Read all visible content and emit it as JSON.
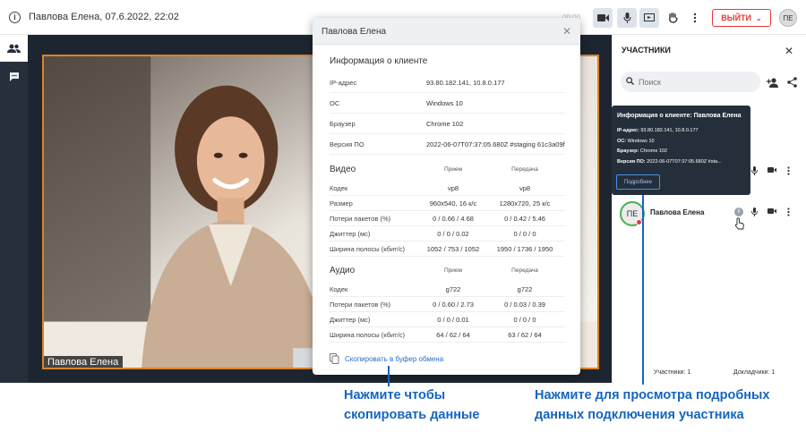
{
  "topbar": {
    "title": "Павлова Елена, 07.6.2022, 22:02",
    "timer": "00:00",
    "exit_label": "ВЫЙТИ",
    "avatar_initials": "ПЕ",
    "icons": [
      "info-icon",
      "camera-icon",
      "mic-icon",
      "screen-share-icon",
      "raise-hand-icon",
      "more-vert-icon"
    ]
  },
  "rail": {
    "icons": [
      "participants-icon",
      "chat-icon"
    ]
  },
  "video": {
    "participant_name": "Павлова Елена"
  },
  "panel": {
    "title": "УЧАСТНИКИ",
    "search_placeholder": "Поиск",
    "participant": {
      "initials": "ПЕ",
      "name": "Павлова Елена"
    },
    "footer_participants": "Участники: 1",
    "footer_speakers": "Докладчики: 1"
  },
  "tooltip": {
    "title": "Информация о клиенте: Павлова Елена",
    "lines": [
      {
        "label": "IP-адрес:",
        "value": "93.80.182.141, 10.8.0.177"
      },
      {
        "label": "ОС:",
        "value": "Windows 10"
      },
      {
        "label": "Браузер:",
        "value": "Chrome 102"
      },
      {
        "label": "Версия ПО:",
        "value": "2022-06-07T07:37:05.680Z #sta..."
      }
    ],
    "details_button": "Подробнее"
  },
  "modal": {
    "title": "Павлова Елена",
    "client_section": "Информация о клиенте",
    "client_rows": [
      {
        "key": "IP-адрес",
        "value": "93.80.182.141, 10.8.0.177"
      },
      {
        "key": "ОС",
        "value": "Windows 10"
      },
      {
        "key": "Браузер",
        "value": "Chrome 102"
      },
      {
        "key": "Версия ПО",
        "value": "2022-06-07T07:37:05.680Z #staging 61c3a09f"
      }
    ],
    "video_section": "Видео",
    "col_receive": "Прием",
    "col_send": "Передача",
    "video_rows": [
      {
        "key": "Кодек",
        "rx": "vp8",
        "tx": "vp8"
      },
      {
        "key": "Размер",
        "rx": "960x540, 16 к/с",
        "tx": "1280x720, 25 к/с"
      },
      {
        "key": "Потери пакетов (%)",
        "rx": "0 / 0.66 / 4.68",
        "tx": "0 / 0.42 / 5.46"
      },
      {
        "key": "Джиттер (мс)",
        "rx": "0 / 0 / 0.02",
        "tx": "0 / 0 / 0"
      },
      {
        "key": "Ширина полосы (кбит/с)",
        "rx": "1052 / 753 / 1052",
        "tx": "1950 / 1736 / 1950"
      }
    ],
    "audio_section": "Аудио",
    "audio_rows": [
      {
        "key": "Кодек",
        "rx": "g722",
        "tx": "g722"
      },
      {
        "key": "Потери пакетов (%)",
        "rx": "0 / 0.60 / 2.73",
        "tx": "0 / 0.03 / 0.39"
      },
      {
        "key": "Джиттер (мс)",
        "rx": "0 / 0 / 0.01",
        "tx": "0 / 0 / 0"
      },
      {
        "key": "Ширина полосы (кбит/с)",
        "rx": "64 / 62 / 64",
        "tx": "63 / 62 / 64"
      }
    ],
    "copy_label": "Скопировать в буфер обмена"
  },
  "annotations": {
    "copy_note_line1": "Нажмите чтобы",
    "copy_note_line2": "скопировать данные",
    "details_note_line1": "Нажмите для просмотра подробных",
    "details_note_line2": "данных подключения участника"
  },
  "colors": {
    "accent": "#1565c0",
    "exit": "#e53935",
    "frame": "#d9832c",
    "dark": "#25303c"
  }
}
